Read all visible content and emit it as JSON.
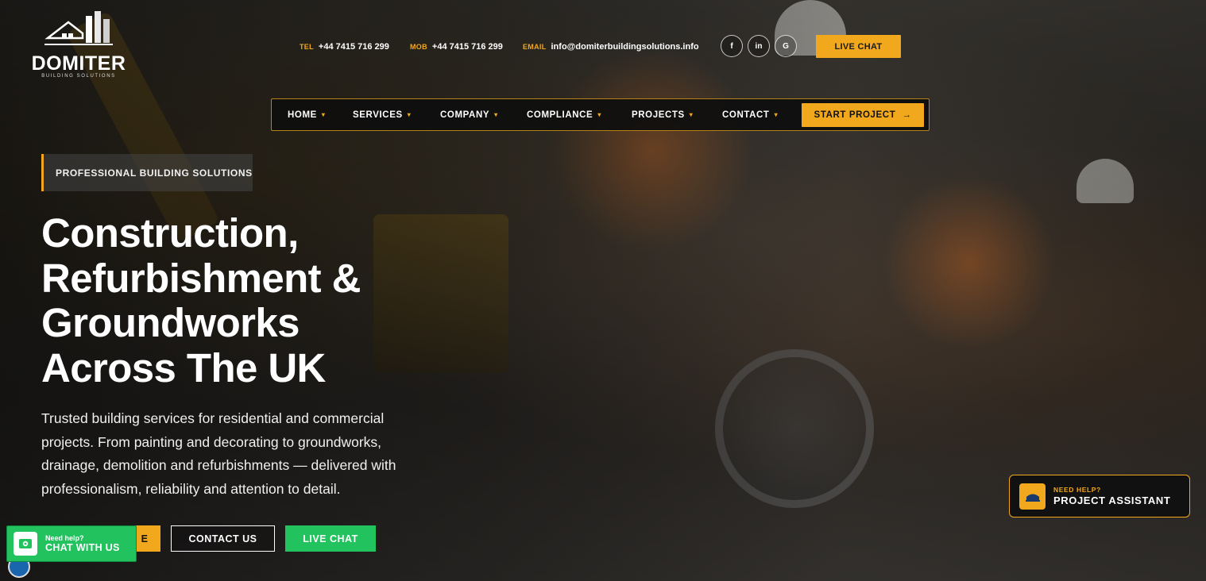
{
  "brand": {
    "name": "DOMITER",
    "tagline": "BUILDING SOLUTIONS",
    "accent": "#f2a81d",
    "green": "#22c35e"
  },
  "contact": {
    "tel_label": "TEL",
    "tel_value": "+44 7415 716 299",
    "mob_label": "MOB",
    "mob_value": "+44 7415 716 299",
    "email_label": "EMAIL",
    "email_value": "info@domiterbuildingsolutions.info"
  },
  "social": [
    {
      "label": "f",
      "icon": "facebook-icon"
    },
    {
      "label": "in",
      "icon": "linkedin-icon"
    },
    {
      "label": "G",
      "icon": "google-icon"
    }
  ],
  "top_live_chat": "LIVE CHAT",
  "nav": {
    "items": [
      {
        "label": "HOME"
      },
      {
        "label": "SERVICES"
      },
      {
        "label": "COMPANY"
      },
      {
        "label": "COMPLIANCE"
      },
      {
        "label": "PROJECTS"
      },
      {
        "label": "CONTACT"
      }
    ],
    "cta": "START PROJECT",
    "cta_arrow": "→",
    "caret": "▾"
  },
  "hero": {
    "eyebrow": "PROFESSIONAL BUILDING SOLUTIONS",
    "headline_lines": [
      "Construction,",
      "Refurbishment &",
      "Groundworks",
      "Across The UK"
    ],
    "lead": "Trusted building services for residential and commercial projects. From painting and decorating to groundworks, drainage, demolition and refurbishments — delivered with professionalism, reliability and attention to detail.",
    "btn_primary": "E",
    "btn_outline": "CONTACT US",
    "btn_green": "LIVE CHAT"
  },
  "chat_widget": {
    "small": "Need help?",
    "big": "CHAT WITH US"
  },
  "assistant": {
    "small": "NEED HELP?",
    "big": "PROJECT ASSISTANT"
  }
}
